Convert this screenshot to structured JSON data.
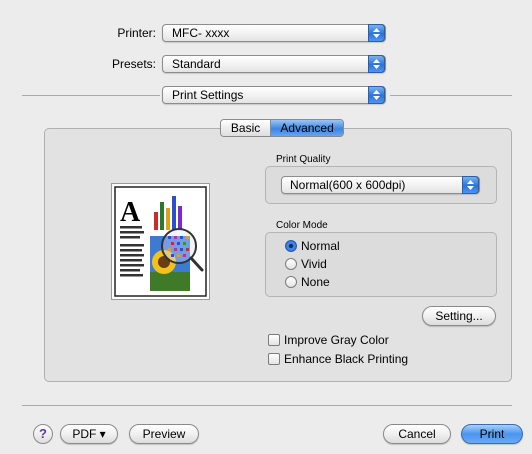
{
  "printer": {
    "label": "Printer:",
    "value": "MFC- xxxx"
  },
  "presets": {
    "label": "Presets:",
    "value": "Standard"
  },
  "panel": {
    "value": "Print Settings"
  },
  "tabs": [
    {
      "label": "Basic",
      "selected": false
    },
    {
      "label": "Advanced",
      "selected": true
    }
  ],
  "print_quality": {
    "label": "Print Quality",
    "value": "Normal(600 x 600dpi)"
  },
  "color_mode": {
    "label": "Color Mode",
    "options": [
      {
        "label": "Normal",
        "selected": true
      },
      {
        "label": "Vivid",
        "selected": false
      },
      {
        "label": "None",
        "selected": false
      }
    ]
  },
  "setting_button": "Setting...",
  "checkboxes": [
    {
      "label": "Improve Gray Color",
      "checked": false
    },
    {
      "label": "Enhance Black Printing",
      "checked": false
    }
  ],
  "preview_letter": "A",
  "bottom": {
    "help": "?",
    "pdf": "PDF ▾",
    "preview": "Preview",
    "cancel": "Cancel",
    "print": "Print"
  },
  "colors": {
    "accent": "#3c86e3",
    "background": "#ececec"
  }
}
